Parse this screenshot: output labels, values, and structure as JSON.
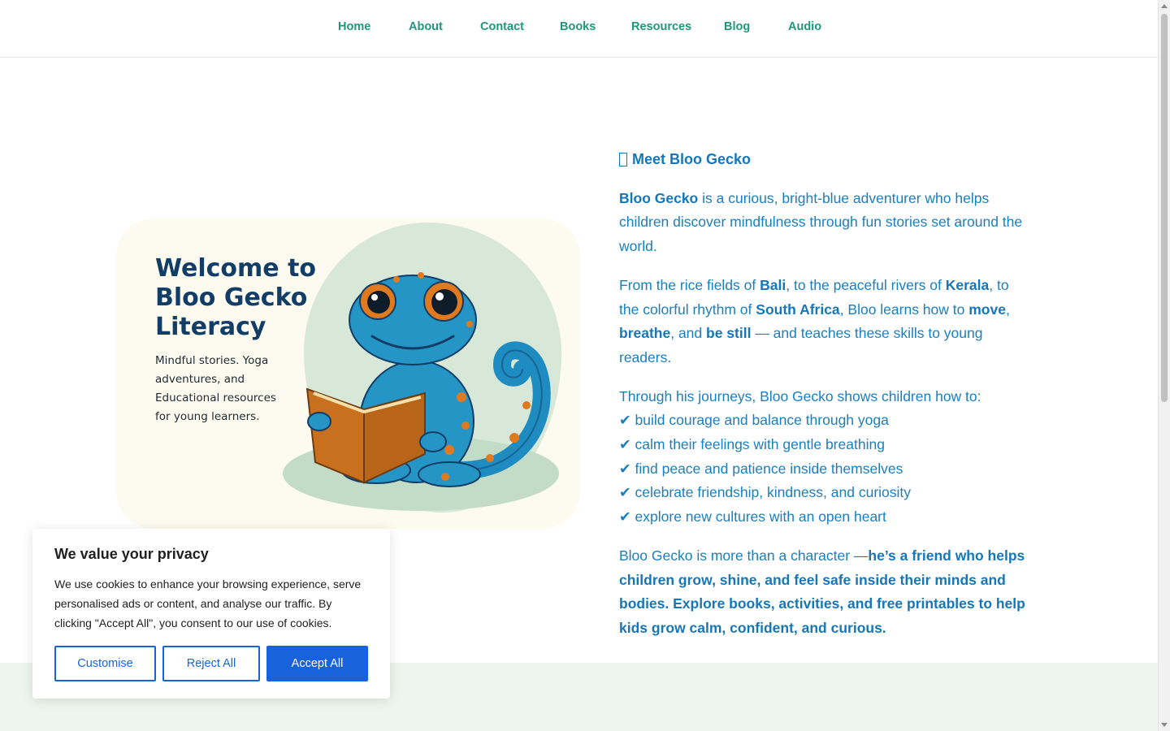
{
  "nav": {
    "items": [
      {
        "label": "Home"
      },
      {
        "label": "About"
      },
      {
        "label": "Contact"
      },
      {
        "label": "Books"
      },
      {
        "label": "Resources"
      },
      {
        "label": "Blog"
      },
      {
        "label": "Audio"
      }
    ]
  },
  "hero": {
    "title": "Welcome to Bloo Gecko Literacy",
    "subtitle": "Mindful stories. Yoga adventures, and Educational resources for young learners.",
    "image_icon": "gecko-reading-book-icon"
  },
  "content": {
    "heading": "Meet Bloo Gecko",
    "heading_icon": "missing-glyph-icon",
    "p1": {
      "bold": "Bloo Gecko",
      "rest": " is a curious, bright-blue adventurer who helps children discover mindfulness through fun stories set around the world."
    },
    "p2": {
      "t1": "From the rice fields of ",
      "bali": "Bali",
      "t2": ", to the peaceful rivers of ",
      "kerala": "Kerala",
      "t3": ", to the colorful rhythm of ",
      "sa": "South Africa",
      "t4": ", Bloo learns how to ",
      "move": "move",
      "t5": ", ",
      "breathe": "breathe",
      "t6": ", and ",
      "still": "be still",
      "t7": " — and teaches these skills to young readers."
    },
    "p3_intro": "Through his journeys, Bloo Gecko shows children how to:",
    "checklist": [
      "✔ build courage and balance through yoga",
      "✔ calm their feelings with gentle breathing",
      "✔ find peace and patience inside themselves",
      "✔ celebrate friendship, kindness, and curiosity",
      "✔ explore new cultures with an open heart"
    ],
    "p4": {
      "plain": "Bloo Gecko is more than a character —",
      "bold": "he’s a friend who helps children grow, shine, and feel safe inside their minds and bodies. Explore books, activities, and free printables to help kids grow calm, confident, and curious."
    }
  },
  "cookie": {
    "title": "We value your privacy",
    "text": "We use cookies to enhance your browsing experience, serve personalised ads or content, and analyse our traffic. By clicking \"Accept All\", you consent to our use of cookies.",
    "customise": "Customise",
    "reject": "Reject All",
    "accept": "Accept All"
  },
  "colors": {
    "nav_link": "#20967a",
    "body_text": "#1a7fbf",
    "accent_button": "#1863dc",
    "hero_title": "#123d67",
    "bottom_band": "#edf5ee"
  }
}
